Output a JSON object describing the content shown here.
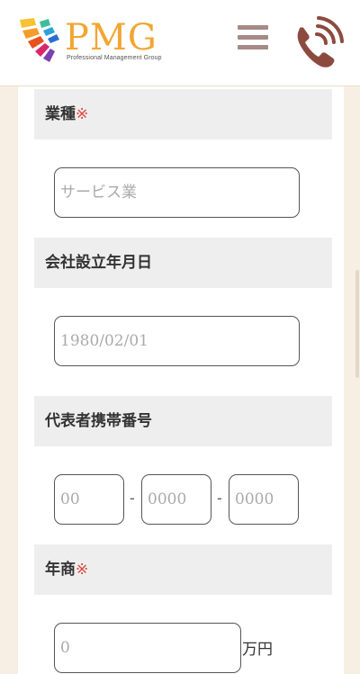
{
  "header": {
    "logo_text": "PMG",
    "logo_subtitle": "Professional Management Group",
    "menu_icon": "hamburger-icon",
    "phone_icon": "phone-icon",
    "colors": {
      "logo_orange": "#f2a632",
      "logo_teal": "#3dbd9c",
      "icon_brown": "#8c4a3f",
      "menu_gray": "#a58a86"
    }
  },
  "form": {
    "industry": {
      "label": "業種",
      "required_mark": "※",
      "placeholder": "サービス業"
    },
    "founded": {
      "label": "会社設立年月日",
      "placeholder": "1980/02/01"
    },
    "phone": {
      "label": "代表者携帯番号",
      "part1_placeholder": "00",
      "part2_placeholder": "0000",
      "part3_placeholder": "0000",
      "separator": "-"
    },
    "revenue": {
      "label": "年商",
      "required_mark": "※",
      "placeholder": "0",
      "unit": "万円"
    }
  }
}
